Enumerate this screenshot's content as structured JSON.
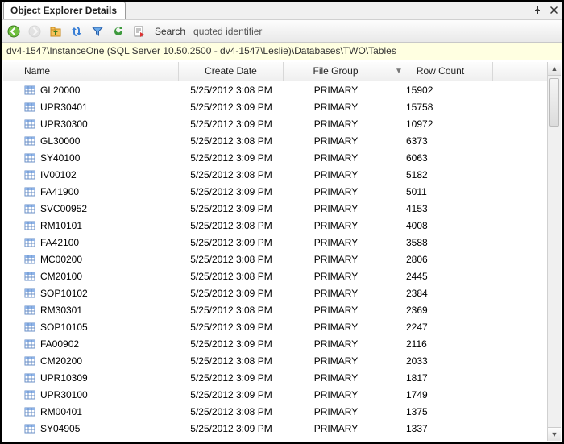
{
  "window": {
    "title": "Object Explorer Details"
  },
  "toolbar": {
    "search_label": "Search",
    "search_value": "quoted identifier"
  },
  "path": "dv4-1547\\InstanceOne (SQL Server 10.50.2500 - dv4-1547\\Leslie)\\Databases\\TWO\\Tables",
  "columns": {
    "name": "Name",
    "create_date": "Create Date",
    "file_group": "File Group",
    "row_count": "Row Count"
  },
  "rows": [
    {
      "name": "GL20000",
      "create_date": "5/25/2012 3:08 PM",
      "file_group": "PRIMARY",
      "row_count": "15902"
    },
    {
      "name": "UPR30401",
      "create_date": "5/25/2012 3:09 PM",
      "file_group": "PRIMARY",
      "row_count": "15758"
    },
    {
      "name": "UPR30300",
      "create_date": "5/25/2012 3:09 PM",
      "file_group": "PRIMARY",
      "row_count": "10972"
    },
    {
      "name": "GL30000",
      "create_date": "5/25/2012 3:08 PM",
      "file_group": "PRIMARY",
      "row_count": "6373"
    },
    {
      "name": "SY40100",
      "create_date": "5/25/2012 3:09 PM",
      "file_group": "PRIMARY",
      "row_count": "6063"
    },
    {
      "name": "IV00102",
      "create_date": "5/25/2012 3:08 PM",
      "file_group": "PRIMARY",
      "row_count": "5182"
    },
    {
      "name": "FA41900",
      "create_date": "5/25/2012 3:09 PM",
      "file_group": "PRIMARY",
      "row_count": "5011"
    },
    {
      "name": "SVC00952",
      "create_date": "5/25/2012 3:09 PM",
      "file_group": "PRIMARY",
      "row_count": "4153"
    },
    {
      "name": "RM10101",
      "create_date": "5/25/2012 3:08 PM",
      "file_group": "PRIMARY",
      "row_count": "4008"
    },
    {
      "name": "FA42100",
      "create_date": "5/25/2012 3:09 PM",
      "file_group": "PRIMARY",
      "row_count": "3588"
    },
    {
      "name": "MC00200",
      "create_date": "5/25/2012 3:08 PM",
      "file_group": "PRIMARY",
      "row_count": "2806"
    },
    {
      "name": "CM20100",
      "create_date": "5/25/2012 3:08 PM",
      "file_group": "PRIMARY",
      "row_count": "2445"
    },
    {
      "name": "SOP10102",
      "create_date": "5/25/2012 3:09 PM",
      "file_group": "PRIMARY",
      "row_count": "2384"
    },
    {
      "name": "RM30301",
      "create_date": "5/25/2012 3:08 PM",
      "file_group": "PRIMARY",
      "row_count": "2369"
    },
    {
      "name": "SOP10105",
      "create_date": "5/25/2012 3:09 PM",
      "file_group": "PRIMARY",
      "row_count": "2247"
    },
    {
      "name": "FA00902",
      "create_date": "5/25/2012 3:09 PM",
      "file_group": "PRIMARY",
      "row_count": "2116"
    },
    {
      "name": "CM20200",
      "create_date": "5/25/2012 3:08 PM",
      "file_group": "PRIMARY",
      "row_count": "2033"
    },
    {
      "name": "UPR10309",
      "create_date": "5/25/2012 3:09 PM",
      "file_group": "PRIMARY",
      "row_count": "1817"
    },
    {
      "name": "UPR30100",
      "create_date": "5/25/2012 3:09 PM",
      "file_group": "PRIMARY",
      "row_count": "1749"
    },
    {
      "name": "RM00401",
      "create_date": "5/25/2012 3:08 PM",
      "file_group": "PRIMARY",
      "row_count": "1375"
    },
    {
      "name": "SY04905",
      "create_date": "5/25/2012 3:09 PM",
      "file_group": "PRIMARY",
      "row_count": "1337"
    }
  ]
}
